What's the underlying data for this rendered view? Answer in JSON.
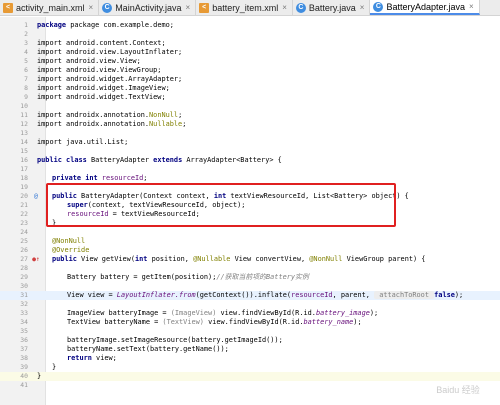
{
  "tabs": [
    {
      "label": "activity_main.xml",
      "icon": "xml-file-icon",
      "active": false
    },
    {
      "label": "MainActivity.java",
      "icon": "java-class-icon",
      "active": false
    },
    {
      "label": "battery_item.xml",
      "icon": "xml-file-icon",
      "active": false
    },
    {
      "label": "Battery.java",
      "icon": "java-class-icon",
      "active": false
    },
    {
      "label": "BatteryAdapter.java",
      "icon": "java-class-icon",
      "active": true
    }
  ],
  "tab_close_glyph": "×",
  "editor": {
    "line_numbers": [
      "1",
      "2",
      "3",
      "4",
      "5",
      "6",
      "7",
      "8",
      "9",
      "10",
      "11",
      "12",
      "13",
      "14",
      "15",
      "16",
      "17",
      "18",
      "19",
      "20",
      "21",
      "22",
      "23",
      "24",
      "25",
      "26",
      "27",
      "28",
      "29",
      "30",
      "31",
      "32",
      "33",
      "34",
      "35",
      "36",
      "37",
      "38",
      "39",
      "40",
      "41"
    ],
    "lines": {
      "l1": {
        "a": "package com.example.demo;"
      },
      "l3": {
        "a": "import android.content.Context;"
      },
      "l4": {
        "a": "import android.view.LayoutInflater;"
      },
      "l5": {
        "a": "import android.view.View;"
      },
      "l6": {
        "a": "import android.view.ViewGroup;"
      },
      "l7": {
        "a": "import android.widget.ArrayAdapter;"
      },
      "l8": {
        "a": "import android.widget.ImageView;"
      },
      "l9": {
        "a": "import android.widget.TextView;"
      },
      "l11": {
        "a": "import androidx.annotation.",
        "b": "NonNull",
        "c": ";"
      },
      "l12": {
        "a": "import androidx.annotation.",
        "b": "Nullable",
        "c": ";"
      },
      "l14": {
        "a": "import java.util.List;"
      },
      "l16": {
        "kw": "public class ",
        "a": "BatteryAdapter ",
        "kw2": "extends ",
        "b": "ArrayAdapter<Battery> {"
      },
      "l18": {
        "kw": "private int ",
        "f": "resourceId",
        "a": ";"
      },
      "l20": {
        "kw": "public ",
        "a": "BatteryAdapter(Context context, ",
        "kw2": "int ",
        "b": "textViewResourceId, List<Battery> object) {"
      },
      "l21": {
        "kw": "super",
        "a": "(context, textViewResourceId, object);"
      },
      "l22": {
        "f": "resourceId",
        "a": " = textViewResourceId;"
      },
      "l23": {
        "a": "}"
      },
      "l25": {
        "ann": "@NonNull"
      },
      "l26": {
        "ann": "@Override"
      },
      "l27": {
        "kw": "public ",
        "a": "View getView(",
        "kw2": "int ",
        "b": "position, ",
        "ann": "@Nullable",
        "c": " View convertView, ",
        "ann2": "@NonNull",
        "d": " ViewGroup parent) {"
      },
      "l29": {
        "a": "Battery battery = getItem(position);",
        "cmt": "//获取当前项的Battery实例"
      },
      "l31": {
        "a": "View view = ",
        "i": "LayoutInflater.from",
        "b": "(getContext()).inflate(",
        "f": "resourceId",
        "c": ", parent, ",
        "hint": " attachToRoot ",
        "kw": "false",
        "d": ");"
      },
      "l33": {
        "a": "ImageView batteryImage = ",
        "g": "(ImageView)",
        "b": " view.findViewById(R.id.",
        "i": "battery_image",
        "c": ");"
      },
      "l34": {
        "a": "TextView batteryName = ",
        "g": "(TextView)",
        "b": " view.findViewById(R.id.",
        "i": "battery_name",
        "c": ");"
      },
      "l36": {
        "a": "batteryImage.setImageResource(battery.getImageId());"
      },
      "l37": {
        "a": "batteryName.setText(battery.getName());"
      },
      "l38": {
        "kw": "return ",
        "a": "view;"
      },
      "l39": {
        "a": "}"
      },
      "l40": {
        "a": "}"
      }
    },
    "gutter_marks": {
      "l20_mark": "@",
      "l27_mark": "●↑"
    }
  },
  "watermark": "Baidu 经验",
  "colors": {
    "highlight_box": "#e02020",
    "active_tab_underline": "#4c8be8"
  }
}
